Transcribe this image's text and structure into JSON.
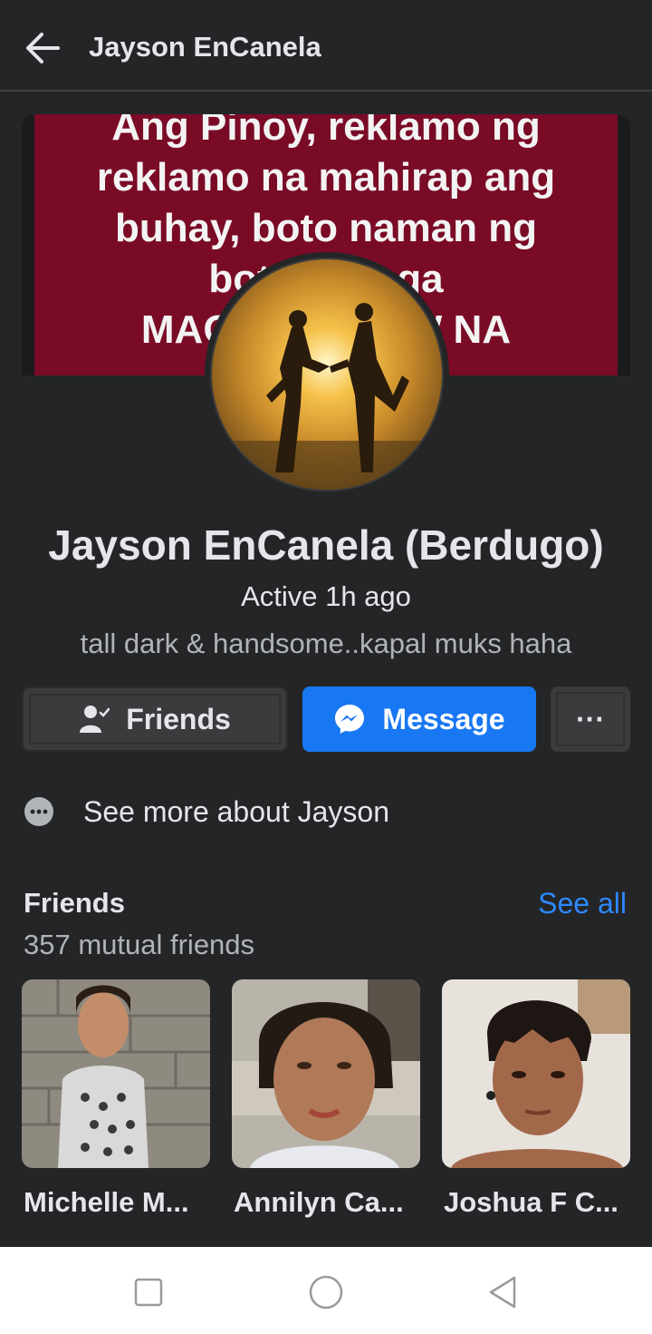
{
  "header": {
    "title": "Jayson EnCanela"
  },
  "cover": {
    "text": "Ang Pinoy, reklamo ng\nreklamo na mahirap ang\nbuhay, boto naman ng\nboto sa mga\nMAGNANAKAW NA\nPO"
  },
  "profile": {
    "name": "Jayson EnCanela (Berdugo)",
    "active": "Active 1h ago",
    "bio": "tall dark & handsome..kapal muks haha"
  },
  "actions": {
    "friends_label": "Friends",
    "message_label": "Message",
    "more_label": "···"
  },
  "about": {
    "label": "See more about Jayson"
  },
  "friends": {
    "title": "Friends",
    "see_all": "See all",
    "mutual": "357 mutual friends",
    "items": [
      {
        "name": "Michelle M..."
      },
      {
        "name": "Annilyn Ca..."
      },
      {
        "name": "Joshua F C..."
      }
    ]
  },
  "colors": {
    "accent": "#1877f2",
    "link": "#2d88ff",
    "background": "#242526",
    "cover": "#7a0b26"
  }
}
